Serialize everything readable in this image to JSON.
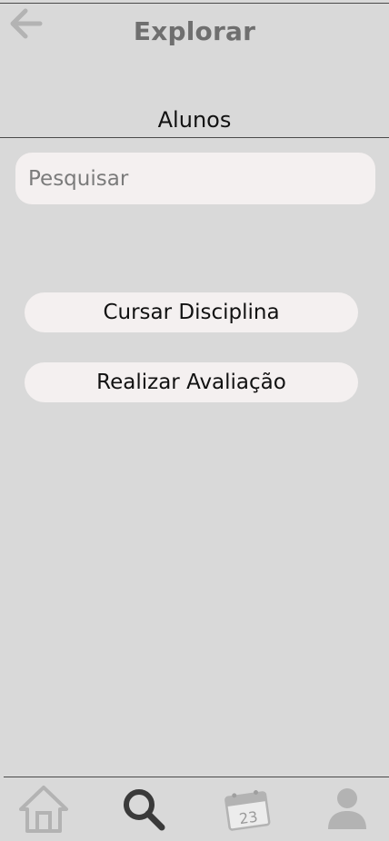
{
  "header": {
    "title": "Explorar",
    "back_icon": "arrow-left-icon"
  },
  "section": {
    "title": "Alunos"
  },
  "search": {
    "placeholder": "Pesquisar",
    "value": ""
  },
  "actions": [
    {
      "label": "Cursar Disciplina"
    },
    {
      "label": "Realizar Avaliação"
    }
  ],
  "bottom_nav": {
    "items": [
      {
        "icon": "home-icon"
      },
      {
        "icon": "search-icon",
        "active": true
      },
      {
        "icon": "calendar-icon",
        "day": "23"
      },
      {
        "icon": "profile-icon"
      }
    ]
  },
  "colors": {
    "background": "#d9d9d9",
    "surface": "#f4f0f0",
    "title_gray": "#6f6f6f",
    "icon_inactive": "#b3b3b3",
    "icon_active": "#3a3a3a",
    "divider": "#4a4a4a"
  }
}
